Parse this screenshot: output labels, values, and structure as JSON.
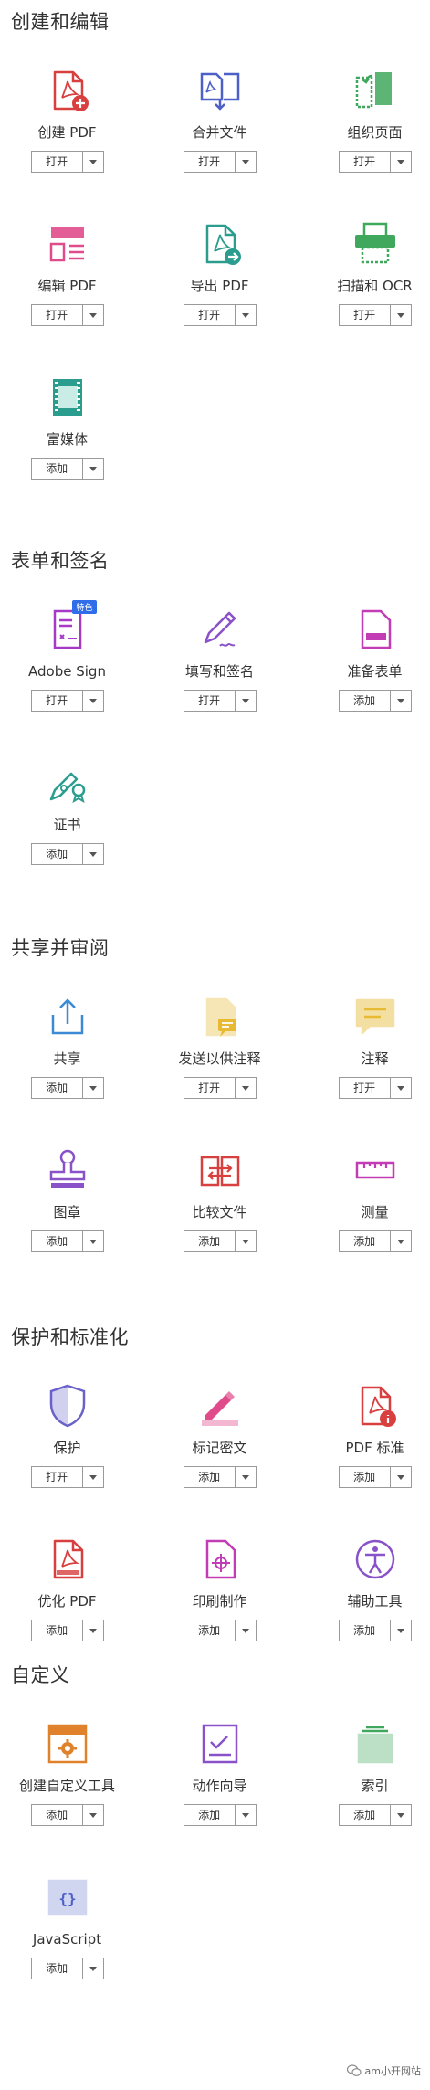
{
  "sections": [
    {
      "title": "创建和编辑",
      "tools": [
        {
          "label": "创建 PDF",
          "button": "打开",
          "icon": "create-pdf-icon",
          "color": "#d8403f"
        },
        {
          "label": "合并文件",
          "button": "打开",
          "icon": "combine-files-icon",
          "color": "#4d60c7"
        },
        {
          "label": "组织页面",
          "button": "打开",
          "icon": "organize-pages-icon",
          "color": "#3fa85c"
        },
        {
          "label": "编辑 PDF",
          "button": "打开",
          "icon": "edit-pdf-icon",
          "color": "#e04b8c"
        },
        {
          "label": "导出 PDF",
          "button": "打开",
          "icon": "export-pdf-icon",
          "color": "#2a9d8f"
        },
        {
          "label": "扫描和 OCR",
          "button": "打开",
          "icon": "scan-ocr-icon",
          "color": "#3fa85c"
        },
        {
          "label": "富媒体",
          "button": "添加",
          "icon": "rich-media-icon",
          "color": "#2a9d8f"
        }
      ]
    },
    {
      "title": "表单和签名",
      "tools": [
        {
          "label": "Adobe Sign",
          "button": "打开",
          "icon": "adobe-sign-icon",
          "color": "#a63ac6",
          "badge": "特色"
        },
        {
          "label": "填写和签名",
          "button": "打开",
          "icon": "fill-sign-icon",
          "color": "#8a52c9"
        },
        {
          "label": "准备表单",
          "button": "添加",
          "icon": "prepare-form-icon",
          "color": "#c13cb5"
        },
        {
          "label": "证书",
          "button": "添加",
          "icon": "certificate-icon",
          "color": "#2a9d8f"
        }
      ]
    },
    {
      "title": "共享并审阅",
      "tools": [
        {
          "label": "共享",
          "button": "添加",
          "icon": "share-icon",
          "color": "#3c8ad6"
        },
        {
          "label": "发送以供注释",
          "button": "打开",
          "icon": "send-comments-icon",
          "color": "#e8b932"
        },
        {
          "label": "注释",
          "button": "打开",
          "icon": "comment-icon",
          "color": "#e8b932"
        },
        {
          "label": "图章",
          "button": "添加",
          "icon": "stamp-icon",
          "color": "#8a52c9"
        },
        {
          "label": "比较文件",
          "button": "添加",
          "icon": "compare-files-icon",
          "color": "#d8403f"
        },
        {
          "label": "测量",
          "button": "添加",
          "icon": "measure-icon",
          "color": "#c13cb5"
        }
      ]
    },
    {
      "title": "保护和标准化",
      "tools": [
        {
          "label": "保护",
          "button": "打开",
          "icon": "protect-icon",
          "color": "#6a62c9"
        },
        {
          "label": "标记密文",
          "button": "添加",
          "icon": "redact-icon",
          "color": "#e04b8c"
        },
        {
          "label": "PDF 标准",
          "button": "添加",
          "icon": "pdf-standards-icon",
          "color": "#d8403f"
        },
        {
          "label": "优化 PDF",
          "button": "添加",
          "icon": "optimize-pdf-icon",
          "color": "#d8403f"
        },
        {
          "label": "印刷制作",
          "button": "添加",
          "icon": "print-production-icon",
          "color": "#c13cb5"
        },
        {
          "label": "辅助工具",
          "button": "添加",
          "icon": "accessibility-icon",
          "color": "#8a52c9"
        }
      ]
    },
    {
      "title": "自定义",
      "tools": [
        {
          "label": "创建自定义工具",
          "button": "添加",
          "icon": "custom-tool-icon",
          "color": "#e0822b"
        },
        {
          "label": "动作向导",
          "button": "添加",
          "icon": "action-wizard-icon",
          "color": "#8a52c9"
        },
        {
          "label": "索引",
          "button": "添加",
          "icon": "index-icon",
          "color": "#3fa85c"
        },
        {
          "label": "JavaScript",
          "button": "添加",
          "icon": "javascript-icon",
          "color": "#4d60c7"
        }
      ]
    }
  ],
  "watermark": "am小开网站"
}
